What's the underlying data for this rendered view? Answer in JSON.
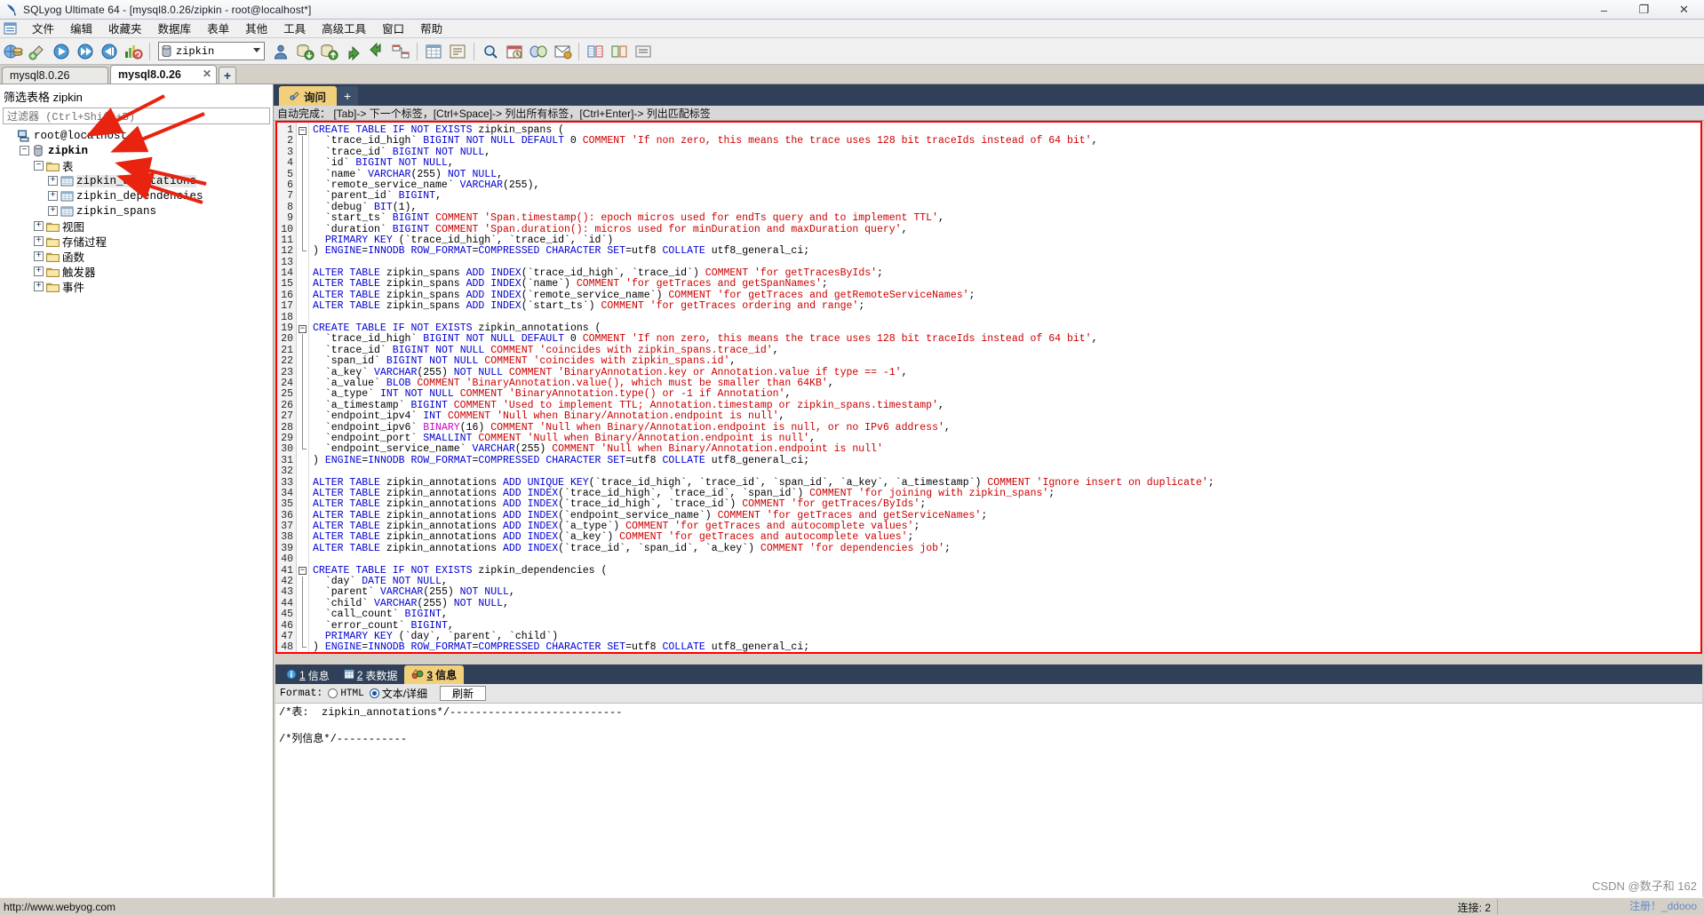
{
  "window": {
    "title": "SQLyog Ultimate 64 - [mysql8.0.26/zipkin - root@localhost*]",
    "app_icon": "sqlyog-icon",
    "minimize": "–",
    "maximize": "❐",
    "close": "✕"
  },
  "menubar": {
    "app_menu_icon": "window-menu-icon",
    "items": [
      {
        "label": "文件",
        "name": "menu-file"
      },
      {
        "label": "编辑",
        "name": "menu-edit"
      },
      {
        "label": "收藏夹",
        "name": "menu-favorites"
      },
      {
        "label": "数据库",
        "name": "menu-database"
      },
      {
        "label": "表单",
        "name": "menu-form"
      },
      {
        "label": "其他",
        "name": "menu-other"
      },
      {
        "label": "工具",
        "name": "menu-tools"
      },
      {
        "label": "高级工具",
        "name": "menu-advanced-tools"
      },
      {
        "label": "窗口",
        "name": "menu-window"
      },
      {
        "label": "帮助",
        "name": "menu-help"
      }
    ]
  },
  "toolbar": {
    "db_selector_value": "zipkin",
    "db_selector_icon": "database-icon",
    "buttons": [
      "new-connection-icon",
      "new-object-icon",
      "execute-icon",
      "execute-all-icon",
      "execute-current-icon",
      "refresh-objects-icon",
      "user-manager-icon",
      "backup-icon",
      "restore-icon",
      "import-icon",
      "export-icon",
      "schema-designer-icon",
      "table-data-icon",
      "query-builder-icon",
      "find-icon",
      "scheduler-icon",
      "sync-icon",
      "notifications-icon",
      "grid-icon",
      "data-compare-icon",
      "options-icon"
    ]
  },
  "connection_tabs": {
    "tabs": [
      {
        "label": "mysql8.0.26",
        "active": false
      },
      {
        "label": "mysql8.0.26",
        "active": true,
        "close": "✕"
      }
    ],
    "new_tab": "+"
  },
  "sidebar": {
    "filter_title": "筛选表格 zipkin",
    "filter_placeholder": "过滤器 (Ctrl+Shift+B)",
    "tree": [
      {
        "label": "root@localhost",
        "icon": "host-icon",
        "indent": 0,
        "expander": "",
        "mono": true
      },
      {
        "label": "zipkin",
        "icon": "database-icon",
        "indent": 1,
        "expander": "−",
        "mono": true,
        "bold": true
      },
      {
        "label": "表",
        "icon": "folder-icon",
        "indent": 2,
        "expander": "−"
      },
      {
        "label": "zipkin_annotations",
        "icon": "table-icon",
        "indent": 3,
        "expander": "+",
        "mono": true,
        "selected": true
      },
      {
        "label": "zipkin_dependencies",
        "icon": "table-icon",
        "indent": 3,
        "expander": "+",
        "mono": true
      },
      {
        "label": "zipkin_spans",
        "icon": "table-icon",
        "indent": 3,
        "expander": "+",
        "mono": true
      },
      {
        "label": "视图",
        "icon": "folder-icon",
        "indent": 2,
        "expander": "+"
      },
      {
        "label": "存储过程",
        "icon": "folder-icon",
        "indent": 2,
        "expander": "+"
      },
      {
        "label": "函数",
        "icon": "folder-icon",
        "indent": 2,
        "expander": "+"
      },
      {
        "label": "触发器",
        "icon": "folder-icon",
        "indent": 2,
        "expander": "+"
      },
      {
        "label": "事件",
        "icon": "folder-icon",
        "indent": 2,
        "expander": "+"
      }
    ]
  },
  "query_tabs": {
    "active_label": "询问",
    "active_icon": "query-icon",
    "new_tab": "+"
  },
  "autocomplete_hint": "自动完成： [Tab]-> 下一个标签，[Ctrl+Space]-> 列出所有标签，[Ctrl+Enter]-> 列出匹配标签",
  "editor": {
    "border_color": "#ff0000",
    "first_line": 1,
    "lines": [
      "CREATE TABLE IF NOT EXISTS zipkin_spans (",
      "  `trace_id_high` BIGINT NOT NULL DEFAULT 0 COMMENT 'If non zero, this means the trace uses 128 bit traceIds instead of 64 bit',",
      "  `trace_id` BIGINT NOT NULL,",
      "  `id` BIGINT NOT NULL,",
      "  `name` VARCHAR(255) NOT NULL,",
      "  `remote_service_name` VARCHAR(255),",
      "  `parent_id` BIGINT,",
      "  `debug` BIT(1),",
      "  `start_ts` BIGINT COMMENT 'Span.timestamp(): epoch micros used for endTs query and to implement TTL',",
      "  `duration` BIGINT COMMENT 'Span.duration(): micros used for minDuration and maxDuration query',",
      "  PRIMARY KEY (`trace_id_high`, `trace_id`, `id`)",
      ") ENGINE=INNODB ROW_FORMAT=COMPRESSED CHARACTER SET=utf8 COLLATE utf8_general_ci;",
      "",
      "ALTER TABLE zipkin_spans ADD INDEX(`trace_id_high`, `trace_id`) COMMENT 'for getTracesByIds';",
      "ALTER TABLE zipkin_spans ADD INDEX(`name`) COMMENT 'for getTraces and getSpanNames';",
      "ALTER TABLE zipkin_spans ADD INDEX(`remote_service_name`) COMMENT 'for getTraces and getRemoteServiceNames';",
      "ALTER TABLE zipkin_spans ADD INDEX(`start_ts`) COMMENT 'for getTraces ordering and range';",
      "",
      "CREATE TABLE IF NOT EXISTS zipkin_annotations (",
      "  `trace_id_high` BIGINT NOT NULL DEFAULT 0 COMMENT 'If non zero, this means the trace uses 128 bit traceIds instead of 64 bit',",
      "  `trace_id` BIGINT NOT NULL COMMENT 'coincides with zipkin_spans.trace_id',",
      "  `span_id` BIGINT NOT NULL COMMENT 'coincides with zipkin_spans.id',",
      "  `a_key` VARCHAR(255) NOT NULL COMMENT 'BinaryAnnotation.key or Annotation.value if type == -1',",
      "  `a_value` BLOB COMMENT 'BinaryAnnotation.value(), which must be smaller than 64KB',",
      "  `a_type` INT NOT NULL COMMENT 'BinaryAnnotation.type() or -1 if Annotation',",
      "  `a_timestamp` BIGINT COMMENT 'Used to implement TTL; Annotation.timestamp or zipkin_spans.timestamp',",
      "  `endpoint_ipv4` INT COMMENT 'Null when Binary/Annotation.endpoint is null',",
      "  `endpoint_ipv6` BINARY(16) COMMENT 'Null when Binary/Annotation.endpoint is null, or no IPv6 address',",
      "  `endpoint_port` SMALLINT COMMENT 'Null when Binary/Annotation.endpoint is null',",
      "  `endpoint_service_name` VARCHAR(255) COMMENT 'Null when Binary/Annotation.endpoint is null'",
      ") ENGINE=INNODB ROW_FORMAT=COMPRESSED CHARACTER SET=utf8 COLLATE utf8_general_ci;",
      "",
      "ALTER TABLE zipkin_annotations ADD UNIQUE KEY(`trace_id_high`, `trace_id`, `span_id`, `a_key`, `a_timestamp`) COMMENT 'Ignore insert on duplicate';",
      "ALTER TABLE zipkin_annotations ADD INDEX(`trace_id_high`, `trace_id`, `span_id`) COMMENT 'for joining with zipkin_spans';",
      "ALTER TABLE zipkin_annotations ADD INDEX(`trace_id_high`, `trace_id`) COMMENT 'for getTraces/ByIds';",
      "ALTER TABLE zipkin_annotations ADD INDEX(`endpoint_service_name`) COMMENT 'for getTraces and getServiceNames';",
      "ALTER TABLE zipkin_annotations ADD INDEX(`a_type`) COMMENT 'for getTraces and autocomplete values';",
      "ALTER TABLE zipkin_annotations ADD INDEX(`a_key`) COMMENT 'for getTraces and autocomplete values';",
      "ALTER TABLE zipkin_annotations ADD INDEX(`trace_id`, `span_id`, `a_key`) COMMENT 'for dependencies job';",
      "",
      "CREATE TABLE IF NOT EXISTS zipkin_dependencies (",
      "  `day` DATE NOT NULL,",
      "  `parent` VARCHAR(255) NOT NULL,",
      "  `child` VARCHAR(255) NOT NULL,",
      "  `call_count` BIGINT,",
      "  `error_count` BIGINT,",
      "  PRIMARY KEY (`day`, `parent`, `child`)",
      ") ENGINE=INNODB ROW_FORMAT=COMPRESSED CHARACTER SET=utf8 COLLATE utf8_general_ci;"
    ]
  },
  "result_tabs": [
    {
      "number": "1",
      "label": "信息",
      "icon": "info-icon",
      "active": false
    },
    {
      "number": "2",
      "label": "表数据",
      "icon": "grid-icon",
      "active": false
    },
    {
      "number": "3",
      "label": "信息",
      "icon": "message-icon",
      "active": true
    }
  ],
  "format_bar": {
    "label": "Format:",
    "option_html": "HTML",
    "option_text": "文本/详细",
    "selected": "text",
    "refresh_label": "刷新"
  },
  "result_body": [
    "/*表:  zipkin_annotations*/---------------------------",
    "",
    "/*列信息*/-----------"
  ],
  "statusbar": {
    "url": "http://www.webyog.com",
    "connections_label": "连接:",
    "connections_value": "2"
  },
  "watermark": {
    "line1": "CSDN @数子和 162",
    "line2": "注册！_ddooo"
  },
  "annotations": {
    "arrow_color": "#e8230f",
    "count": 4
  }
}
